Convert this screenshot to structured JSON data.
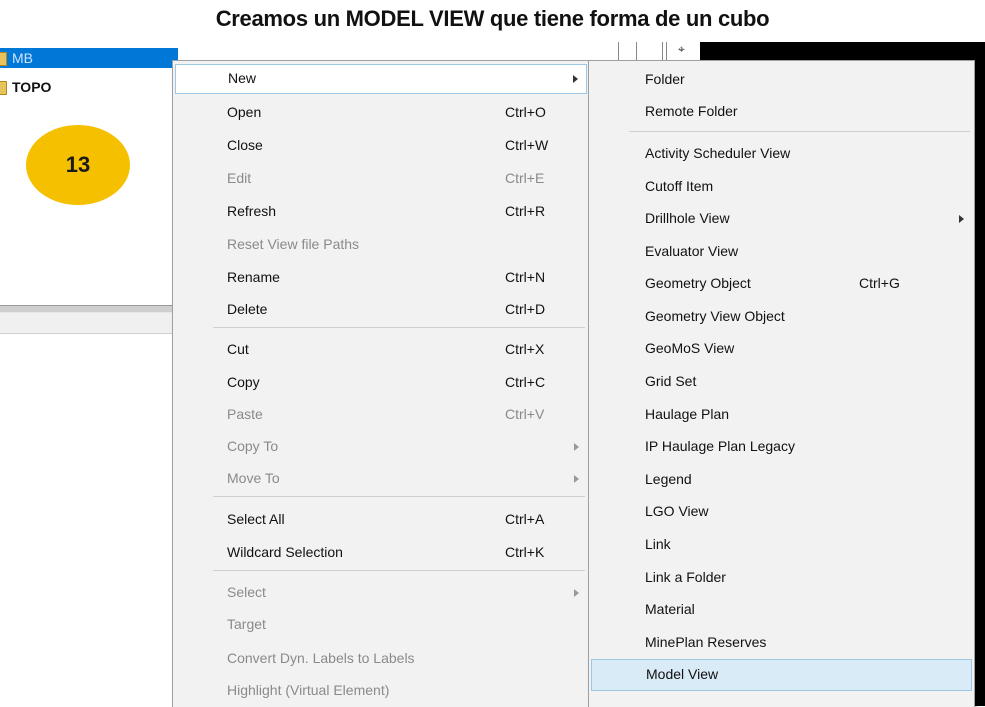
{
  "slide_title": "Creamos un MODEL VIEW que tiene forma de un cubo",
  "step_badge": "13",
  "tree": {
    "items": [
      {
        "label": "MB"
      },
      {
        "label": "TOPO"
      }
    ]
  },
  "context_menu": {
    "items": [
      {
        "label": "New",
        "shortcut": "",
        "disabled": false,
        "submenu": true
      },
      {
        "label": "Open",
        "shortcut": "Ctrl+O",
        "disabled": false
      },
      {
        "label": "Close",
        "shortcut": "Ctrl+W",
        "disabled": false
      },
      {
        "label": "Edit",
        "shortcut": "Ctrl+E",
        "disabled": true
      },
      {
        "label": "Refresh",
        "shortcut": "Ctrl+R",
        "disabled": false
      },
      {
        "label": "Reset View file Paths",
        "shortcut": "",
        "disabled": true
      },
      {
        "label": "Rename",
        "shortcut": "Ctrl+N",
        "disabled": false
      },
      {
        "label": "Delete",
        "shortcut": "Ctrl+D",
        "disabled": false
      },
      {
        "label": "Cut",
        "shortcut": "Ctrl+X",
        "disabled": false
      },
      {
        "label": "Copy",
        "shortcut": "Ctrl+C",
        "disabled": false
      },
      {
        "label": "Paste",
        "shortcut": "Ctrl+V",
        "disabled": true
      },
      {
        "label": "Copy To",
        "shortcut": "",
        "disabled": true,
        "submenu": true
      },
      {
        "label": "Move To",
        "shortcut": "",
        "disabled": true,
        "submenu": true
      },
      {
        "label": "Select All",
        "shortcut": "Ctrl+A",
        "disabled": false
      },
      {
        "label": "Wildcard Selection",
        "shortcut": "Ctrl+K",
        "disabled": false
      },
      {
        "label": "Select",
        "shortcut": "",
        "disabled": true,
        "submenu": true
      },
      {
        "label": "Target",
        "shortcut": "",
        "disabled": true
      },
      {
        "label": "Convert Dyn. Labels to Labels",
        "shortcut": "",
        "disabled": true
      },
      {
        "label": "Highlight (Virtual Element)",
        "shortcut": "",
        "disabled": true
      }
    ]
  },
  "new_submenu": {
    "items": [
      {
        "label": "Folder",
        "shortcut": ""
      },
      {
        "label": "Remote Folder",
        "shortcut": ""
      },
      {
        "label": "Activity Scheduler View",
        "shortcut": ""
      },
      {
        "label": "Cutoff Item",
        "shortcut": ""
      },
      {
        "label": "Drillhole View",
        "shortcut": "",
        "submenu": true
      },
      {
        "label": "Evaluator View",
        "shortcut": ""
      },
      {
        "label": "Geometry Object",
        "shortcut": "Ctrl+G"
      },
      {
        "label": "Geometry View Object",
        "shortcut": ""
      },
      {
        "label": "GeoMoS View",
        "shortcut": ""
      },
      {
        "label": "Grid Set",
        "shortcut": ""
      },
      {
        "label": "Haulage Plan",
        "shortcut": ""
      },
      {
        "label": "IP Haulage Plan Legacy",
        "shortcut": ""
      },
      {
        "label": "Legend",
        "shortcut": ""
      },
      {
        "label": "LGO View",
        "shortcut": ""
      },
      {
        "label": "Link",
        "shortcut": ""
      },
      {
        "label": "Link a Folder",
        "shortcut": ""
      },
      {
        "label": "Material",
        "shortcut": ""
      },
      {
        "label": "MinePlan Reserves",
        "shortcut": ""
      },
      {
        "label": "Model View",
        "shortcut": "",
        "highlighted": true
      }
    ]
  }
}
